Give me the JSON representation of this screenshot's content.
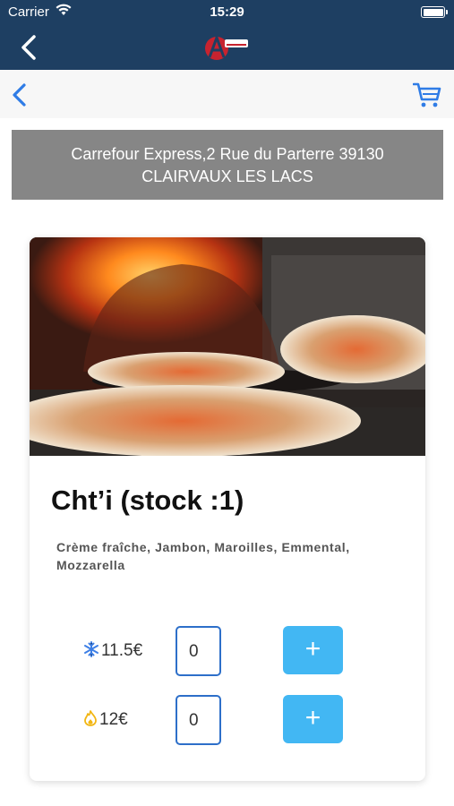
{
  "status_bar": {
    "carrier": "Carrier",
    "time": "15:29"
  },
  "header": {
    "logo_alt": "Pizza"
  },
  "address": {
    "line1": "Carrefour Express,2 Rue du Parterre 39130",
    "line2": "CLAIRVAUX LES LACS"
  },
  "product": {
    "title": "Cht’i (stock :1)",
    "description": "Crème fraîche, Jambon, Maroilles, Emmental, Mozzarella",
    "options": [
      {
        "icon": "snowflake-icon",
        "price": "11.5€",
        "quantity": "0",
        "add_label": "+"
      },
      {
        "icon": "flame-icon",
        "price": "12€",
        "quantity": "0",
        "add_label": "+"
      }
    ]
  },
  "colors": {
    "header_bg": "#1e3f62",
    "accent_blue": "#2d6fc9",
    "add_button": "#42b7f3",
    "address_bg": "#868686"
  }
}
